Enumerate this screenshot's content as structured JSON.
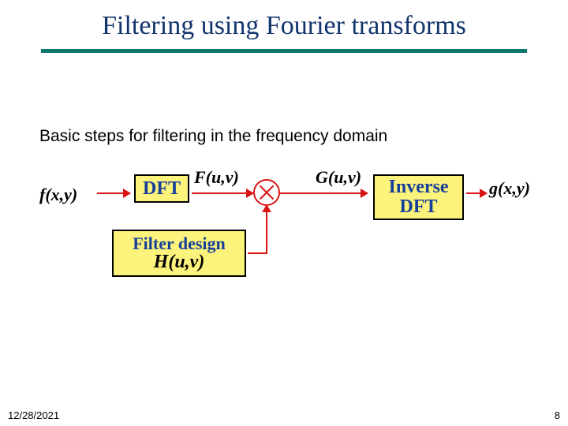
{
  "title": "Filtering using Fourier transforms",
  "caption": "Basic steps for filtering in the frequency domain",
  "footer": {
    "date": "12/28/2021",
    "page": "8"
  },
  "diagram": {
    "fxy": "f(x,y)",
    "dft": "DFT",
    "Fuv": "F(u,v)",
    "Guv": "G(u,v)",
    "idft_line1": "Inverse",
    "idft_line2": "DFT",
    "gxy": "g(x,y)",
    "filter_line1": "Filter design",
    "filter_line2": "H(u,v)"
  }
}
